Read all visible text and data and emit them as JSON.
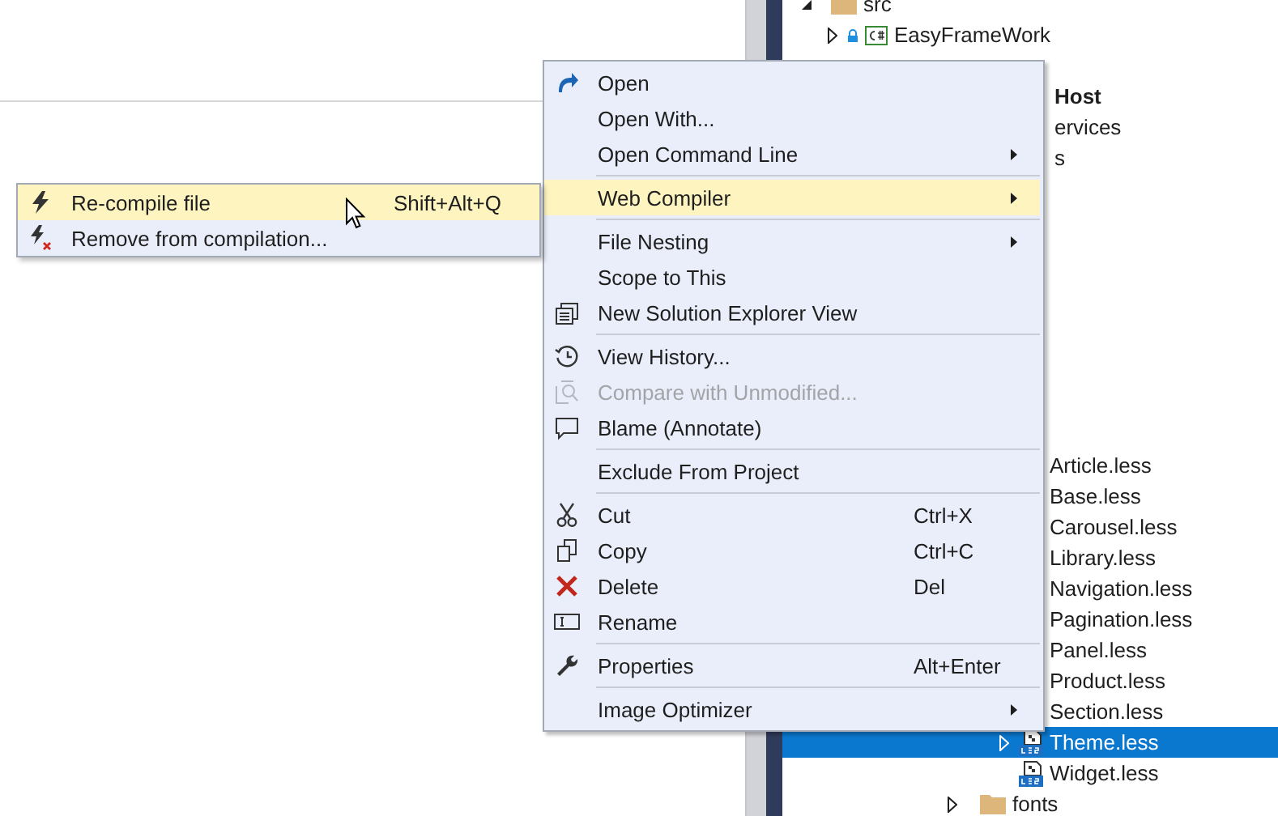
{
  "context_menu": {
    "items": [
      {
        "kind": "item",
        "label": "Open",
        "selected": false,
        "disabled": false,
        "submenu": false
      },
      {
        "kind": "item",
        "label": "Open With...",
        "selected": false,
        "disabled": false,
        "submenu": false
      },
      {
        "kind": "item",
        "label": "Open Command Line",
        "selected": false,
        "disabled": false,
        "submenu": true
      },
      {
        "kind": "separator"
      },
      {
        "kind": "item",
        "label": "Web Compiler",
        "selected": true,
        "disabled": false,
        "submenu": true
      },
      {
        "kind": "separator"
      },
      {
        "kind": "item",
        "label": "File Nesting",
        "selected": false,
        "disabled": false,
        "submenu": true
      },
      {
        "kind": "item",
        "label": "Scope to This",
        "selected": false,
        "disabled": false,
        "submenu": false
      },
      {
        "kind": "item",
        "label": "New Solution Explorer View",
        "selected": false,
        "disabled": false,
        "submenu": false
      },
      {
        "kind": "separator"
      },
      {
        "kind": "item",
        "label": "View History...",
        "selected": false,
        "disabled": false,
        "submenu": false
      },
      {
        "kind": "item",
        "label": "Compare with Unmodified...",
        "selected": false,
        "disabled": true,
        "submenu": false
      },
      {
        "kind": "item",
        "label": "Blame (Annotate)",
        "selected": false,
        "disabled": false,
        "submenu": false
      },
      {
        "kind": "separator"
      },
      {
        "kind": "item",
        "label": "Exclude From Project",
        "selected": false,
        "disabled": false,
        "submenu": false
      },
      {
        "kind": "separator"
      },
      {
        "kind": "item",
        "label": "Cut",
        "shortcut": "Ctrl+X",
        "selected": false,
        "disabled": false,
        "submenu": false
      },
      {
        "kind": "item",
        "label": "Copy",
        "shortcut": "Ctrl+C",
        "selected": false,
        "disabled": false,
        "submenu": false
      },
      {
        "kind": "item",
        "label": "Delete",
        "shortcut": "Del",
        "selected": false,
        "disabled": false,
        "submenu": false
      },
      {
        "kind": "item",
        "label": "Rename",
        "selected": false,
        "disabled": false,
        "submenu": false
      },
      {
        "kind": "separator"
      },
      {
        "kind": "item",
        "label": "Properties",
        "shortcut": "Alt+Enter",
        "selected": false,
        "disabled": false,
        "submenu": false
      },
      {
        "kind": "separator"
      },
      {
        "kind": "item",
        "label": "Image Optimizer",
        "selected": false,
        "disabled": false,
        "submenu": true
      }
    ]
  },
  "submenu": {
    "items": [
      {
        "label": "Re-compile file",
        "shortcut": "Shift+Alt+Q",
        "selected": true
      },
      {
        "label": "Remove from compilation...",
        "selected": false
      }
    ]
  },
  "solution_explorer": {
    "tree": [
      {
        "label": "src",
        "expanded": true,
        "children": [
          {
            "label": "EasyFrameWork",
            "expanded": false,
            "locked": true
          }
        ]
      }
    ],
    "cut_rows": [
      {
        "label": "Host",
        "bold": true
      },
      {
        "label": "ervices",
        "bold": false
      },
      {
        "label": "s",
        "bold": false
      }
    ],
    "files": [
      {
        "label": "Article.less",
        "selected": false
      },
      {
        "label": "Base.less",
        "selected": false
      },
      {
        "label": "Carousel.less",
        "selected": false
      },
      {
        "label": "Library.less",
        "selected": false
      },
      {
        "label": "Navigation.less",
        "selected": false
      },
      {
        "label": "Pagination.less",
        "selected": false
      },
      {
        "label": "Panel.less",
        "selected": false
      },
      {
        "label": "Product.less",
        "selected": false
      },
      {
        "label": "Section.less",
        "selected": false
      },
      {
        "label": "Theme.less",
        "selected": true,
        "expandable": true
      },
      {
        "label": "Widget.less",
        "selected": false,
        "expandable": false
      }
    ],
    "folders": [
      {
        "label": "fonts",
        "expanded": false
      }
    ]
  }
}
